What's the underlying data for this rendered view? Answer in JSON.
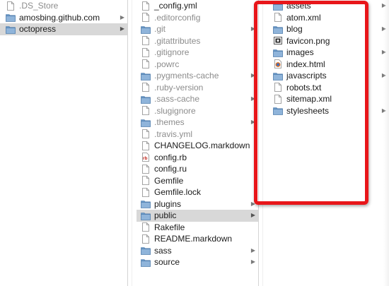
{
  "columns": {
    "left": {
      "items": [
        {
          "name": ".DS_Store",
          "kind": "doc",
          "dim": true,
          "selected": false,
          "hasChildren": false
        },
        {
          "name": "amosbing.github.com",
          "kind": "folder",
          "dim": false,
          "selected": false,
          "hasChildren": true
        },
        {
          "name": "octopress",
          "kind": "folder",
          "dim": false,
          "selected": true,
          "hasChildren": true
        }
      ]
    },
    "middle": {
      "items": [
        {
          "name": "_config.yml",
          "kind": "doc",
          "dim": false,
          "selected": false,
          "hasChildren": false
        },
        {
          "name": ".editorconfig",
          "kind": "doc",
          "dim": true,
          "selected": false,
          "hasChildren": false
        },
        {
          "name": ".git",
          "kind": "folder",
          "dim": true,
          "selected": false,
          "hasChildren": true
        },
        {
          "name": ".gitattributes",
          "kind": "doc",
          "dim": true,
          "selected": false,
          "hasChildren": false
        },
        {
          "name": ".gitignore",
          "kind": "doc",
          "dim": true,
          "selected": false,
          "hasChildren": false
        },
        {
          "name": ".powrc",
          "kind": "doc",
          "dim": true,
          "selected": false,
          "hasChildren": false
        },
        {
          "name": ".pygments-cache",
          "kind": "folder",
          "dim": true,
          "selected": false,
          "hasChildren": true
        },
        {
          "name": ".ruby-version",
          "kind": "doc",
          "dim": true,
          "selected": false,
          "hasChildren": false
        },
        {
          "name": ".sass-cache",
          "kind": "folder",
          "dim": true,
          "selected": false,
          "hasChildren": true
        },
        {
          "name": ".slugignore",
          "kind": "doc",
          "dim": true,
          "selected": false,
          "hasChildren": false
        },
        {
          "name": ".themes",
          "kind": "folder",
          "dim": true,
          "selected": false,
          "hasChildren": true
        },
        {
          "name": ".travis.yml",
          "kind": "doc",
          "dim": true,
          "selected": false,
          "hasChildren": false
        },
        {
          "name": "CHANGELOG.markdown",
          "kind": "doc",
          "dim": false,
          "selected": false,
          "hasChildren": false
        },
        {
          "name": "config.rb",
          "kind": "ruby",
          "dim": false,
          "selected": false,
          "hasChildren": false
        },
        {
          "name": "config.ru",
          "kind": "doc",
          "dim": false,
          "selected": false,
          "hasChildren": false
        },
        {
          "name": "Gemfile",
          "kind": "doc",
          "dim": false,
          "selected": false,
          "hasChildren": false
        },
        {
          "name": "Gemfile.lock",
          "kind": "doc",
          "dim": false,
          "selected": false,
          "hasChildren": false
        },
        {
          "name": "plugins",
          "kind": "folder",
          "dim": false,
          "selected": false,
          "hasChildren": true
        },
        {
          "name": "public",
          "kind": "folder",
          "dim": false,
          "selected": true,
          "hasChildren": true
        },
        {
          "name": "Rakefile",
          "kind": "doc",
          "dim": false,
          "selected": false,
          "hasChildren": false
        },
        {
          "name": "README.markdown",
          "kind": "doc",
          "dim": false,
          "selected": false,
          "hasChildren": false
        },
        {
          "name": "sass",
          "kind": "folder",
          "dim": false,
          "selected": false,
          "hasChildren": true
        },
        {
          "name": "source",
          "kind": "folder",
          "dim": false,
          "selected": false,
          "hasChildren": true
        }
      ]
    },
    "right": {
      "items": [
        {
          "name": "assets",
          "kind": "folder",
          "dim": false,
          "selected": false,
          "hasChildren": true
        },
        {
          "name": "atom.xml",
          "kind": "doc",
          "dim": false,
          "selected": false,
          "hasChildren": false
        },
        {
          "name": "blog",
          "kind": "folder",
          "dim": false,
          "selected": false,
          "hasChildren": true
        },
        {
          "name": "favicon.png",
          "kind": "image",
          "dim": false,
          "selected": false,
          "hasChildren": false
        },
        {
          "name": "images",
          "kind": "folder",
          "dim": false,
          "selected": false,
          "hasChildren": true
        },
        {
          "name": "index.html",
          "kind": "html",
          "dim": false,
          "selected": false,
          "hasChildren": false
        },
        {
          "name": "javascripts",
          "kind": "folder",
          "dim": false,
          "selected": false,
          "hasChildren": true
        },
        {
          "name": "robots.txt",
          "kind": "doc",
          "dim": false,
          "selected": false,
          "hasChildren": false
        },
        {
          "name": "sitemap.xml",
          "kind": "doc",
          "dim": false,
          "selected": false,
          "hasChildren": false
        },
        {
          "name": "stylesheets",
          "kind": "folder",
          "dim": false,
          "selected": false,
          "hasChildren": true
        }
      ]
    }
  },
  "icons": {
    "folder": "folder-icon",
    "doc": "document-icon",
    "ruby": "ruby-file-icon",
    "image": "image-file-icon",
    "html": "html-file-icon",
    "chevron": "chevron-right-icon"
  },
  "colors": {
    "selection": "#d8d8d8",
    "folder_fill": "#6b9ac9",
    "folder_tab": "#8fb4da",
    "highlight": "#e8161a",
    "dim_text": "#8c8c8c"
  }
}
